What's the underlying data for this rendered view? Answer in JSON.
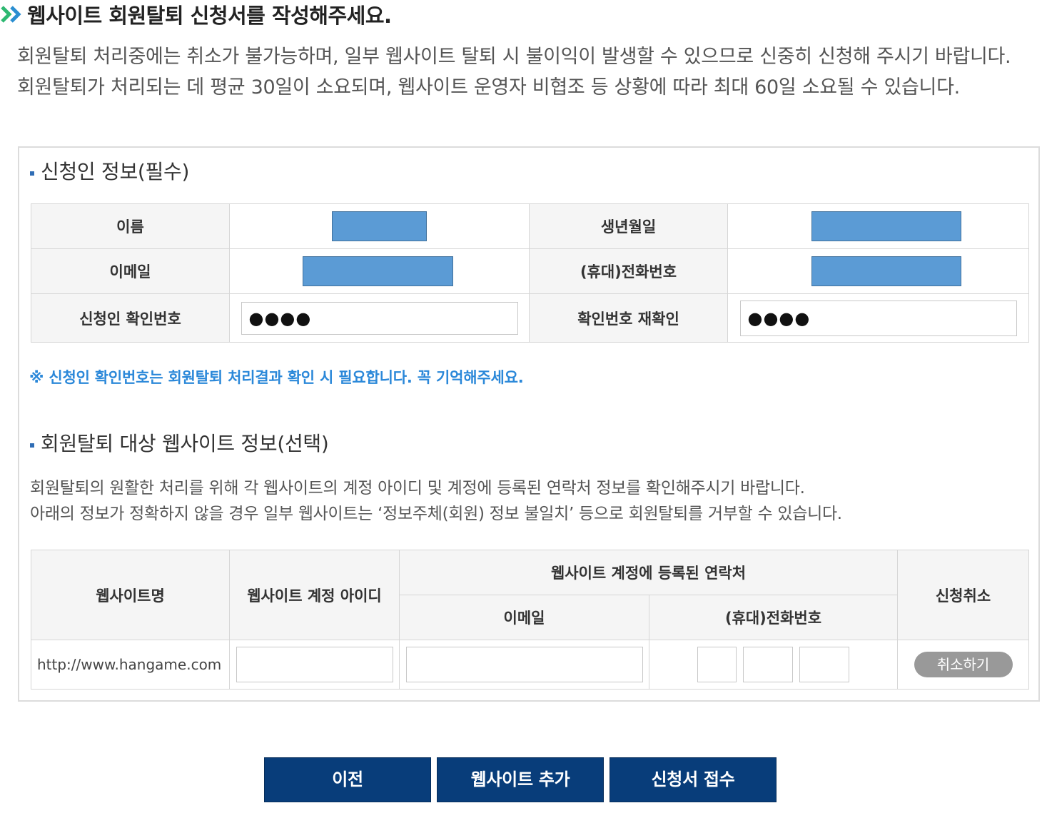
{
  "page": {
    "title": "웹사이트 회원탈퇴 신청서를 작성해주세요.",
    "intro": "회원탈퇴 처리중에는 취소가 불가능하며, 일부 웹사이트 탈퇴 시 불이익이 발생할 수 있으므로 신중히 신청해 주시기 바랍니다. 회원탈퇴가 처리되는 데 평균 30일이 소요되며, 웹사이트 운영자 비협조 등 상황에 따라 최대 60일 소요될 수 있습니다."
  },
  "applicant": {
    "section_title": "신청인 정보(필수)",
    "name_label": "이름",
    "birth_label": "생년월일",
    "email_label": "이메일",
    "phone_label": "(휴대)전화번호",
    "pin_label": "신청인 확인번호",
    "pin_value": "●●●●",
    "pin_confirm_label": "확인번호 재확인",
    "pin_confirm_value": "●●●●",
    "note": "※ 신청인 확인번호는 회원탈퇴 처리결과 확인 시 필요합니다. 꼭 기억해주세요.",
    "redaction_color": "#5b9bd5"
  },
  "websites": {
    "section_title": "회원탈퇴 대상 웹사이트 정보(선택)",
    "desc_line1": "회원탈퇴의 원활한 처리를 위해 각 웹사이트의 계정 아이디 및 계정에 등록된 연락처 정보를 확인해주시기 바랍니다.",
    "desc_line2": "아래의 정보가 정확하지 않을 경우 일부 웹사이트는 ‘정보주체(회원) 정보 불일치’ 등으로 회원탈퇴를 거부할 수 있습니다.",
    "headers": {
      "site_name": "웹사이트명",
      "account_id": "웹사이트 계정 아이디",
      "contact_group": "웹사이트 계정에 등록된 연락처",
      "email": "이메일",
      "phone": "(휴대)전화번호",
      "cancel": "신청취소"
    },
    "rows": [
      {
        "url": "http://www.hangame.com",
        "cancel_label": "취소하기"
      }
    ]
  },
  "buttons": {
    "prev": "이전",
    "add_site": "웹사이트 추가",
    "submit": "신청서 접수"
  },
  "colors": {
    "accent_blue": "#2b88d9",
    "button_navy": "#083d7a",
    "chevron_green": "#2eb872"
  }
}
